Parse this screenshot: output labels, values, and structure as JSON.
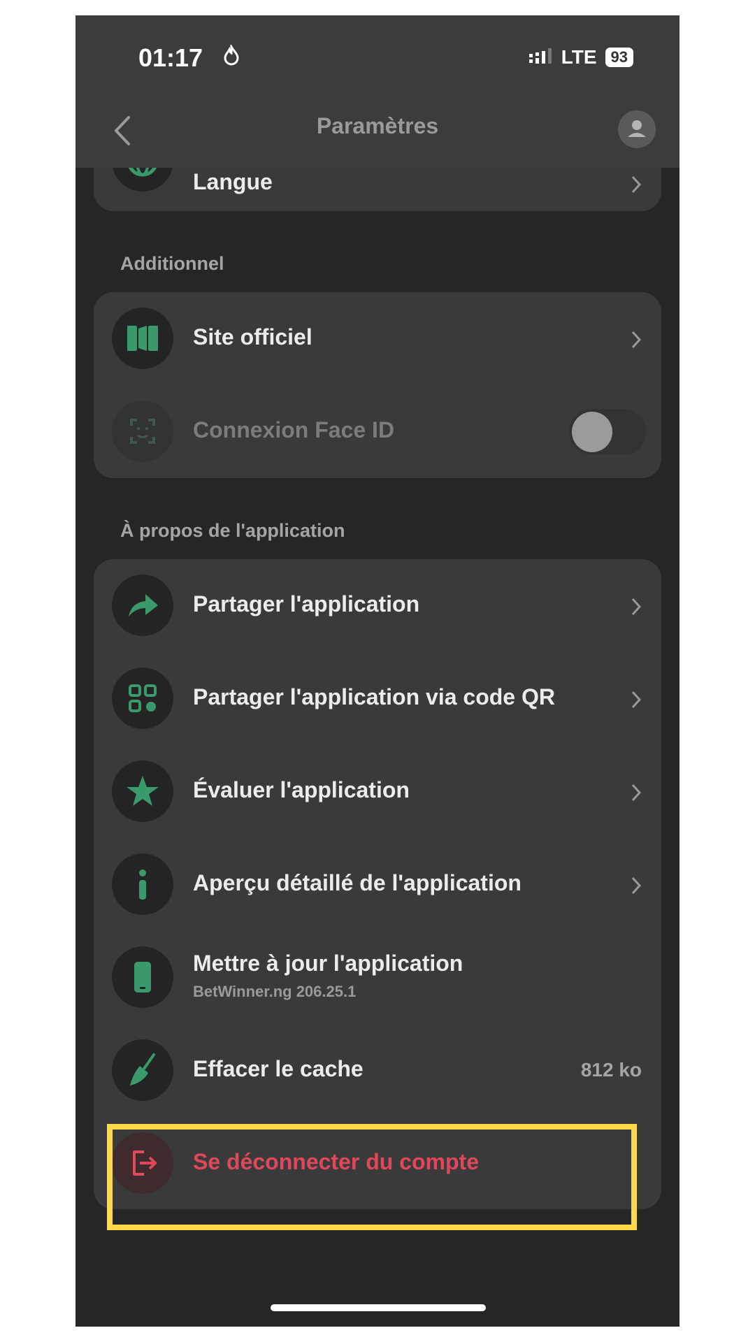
{
  "status_bar": {
    "time": "01:17",
    "network": "LTE",
    "battery": "93"
  },
  "nav": {
    "title": "Paramètres"
  },
  "top_card": {
    "partial_item_label": "Langue"
  },
  "sections": {
    "additionnel": {
      "title": "Additionnel",
      "items": [
        {
          "label": "Site officiel",
          "icon": "site-icon",
          "chevron": true
        },
        {
          "label": "Connexion Face ID",
          "icon": "face-id-icon",
          "toggle": false,
          "disabled": true
        }
      ]
    },
    "about": {
      "title": "À propos de l'application",
      "items": [
        {
          "label": "Partager l'application",
          "icon": "share-icon"
        },
        {
          "label": "Partager l'application via code QR",
          "icon": "qr-code-icon"
        },
        {
          "label": "Évaluer l'application",
          "icon": "star-icon"
        },
        {
          "label": "Aperçu détaillé de l'application",
          "icon": "info-icon"
        },
        {
          "label": "Mettre à jour l'application",
          "sublabel": "BetWinner.ng 206.25.1",
          "icon": "phone-icon"
        },
        {
          "label": "Effacer le cache",
          "value": "812 ko",
          "icon": "broom-icon"
        },
        {
          "label": "Se déconnecter du compte",
          "icon": "logout-icon",
          "highlighted": true
        }
      ]
    }
  },
  "colors": {
    "accent_green": "#3a9a6c",
    "logout_red": "#e0475a",
    "highlight_yellow": "#ffd94a",
    "background": "#262626",
    "card": "#3a3a3a"
  }
}
